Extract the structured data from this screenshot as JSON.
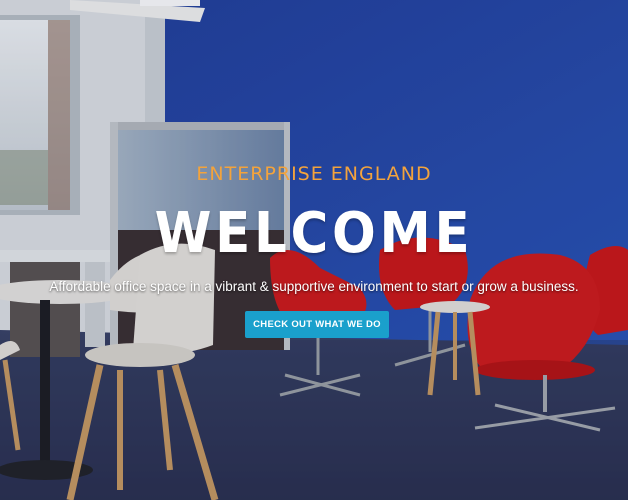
{
  "hero": {
    "eyebrow": "ENTERPRISE ENGLAND",
    "title": "WELCOME",
    "subtitle": "Affordable office space in a vibrant & supportive environment to start or grow a business.",
    "cta_label": "CHECK OUT WHAT WE DO"
  },
  "colors": {
    "accent": "#f3a33c",
    "button": "#1aa0cc",
    "wall": "#1f3a8f",
    "chair_red": "#d11a1a"
  }
}
